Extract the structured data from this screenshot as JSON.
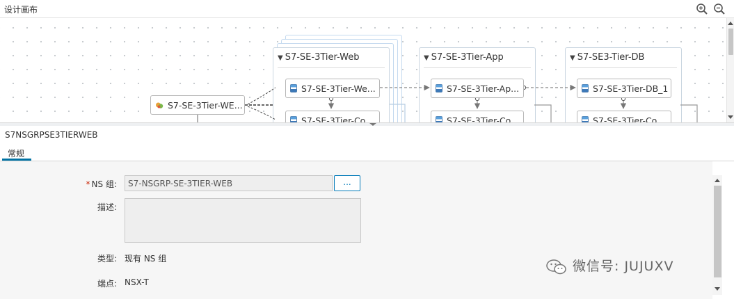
{
  "canvas": {
    "title": "设计画布",
    "zoom_in_icon": "zoom-in-icon",
    "zoom_out_icon": "zoom-out-icon"
  },
  "diagram": {
    "source_node": "S7-SE-3Tier-WE...",
    "groups": [
      {
        "title": "S7-SE-3Tier-Web",
        "nodes": [
          "S7-SE-3Tier-We...",
          "S7-SE-3Tier-Co..."
        ]
      },
      {
        "title": "S7-SE-3Tier-App",
        "nodes": [
          "S7-SE-3Tier-Ap...",
          "S7-SE-3Tier-Co..."
        ]
      },
      {
        "title": "S7-SE3-Tier-DB",
        "nodes": [
          "S7-SE-3Tier-DB_1",
          "S7-SE-3Tier-Co..."
        ]
      }
    ]
  },
  "details": {
    "title": "S7NSGRPSE3TIERWEB",
    "tabs": [
      {
        "label": "常规"
      }
    ],
    "form": {
      "ns_group_label": "NS 组:",
      "ns_group_value": "S7-NSGRP-SE-3TIER-WEB",
      "browse_label": "...",
      "description_label": "描述:",
      "description_value": "",
      "type_label": "类型:",
      "type_value": "现有 NS 组",
      "endpoint_label": "端点:",
      "endpoint_value": "NSX-T"
    }
  },
  "watermark": {
    "text": "微信号: JUJUXV"
  },
  "colors": {
    "accent": "#0072a3",
    "button_blue": "#0079b8",
    "required": "#c92100"
  }
}
